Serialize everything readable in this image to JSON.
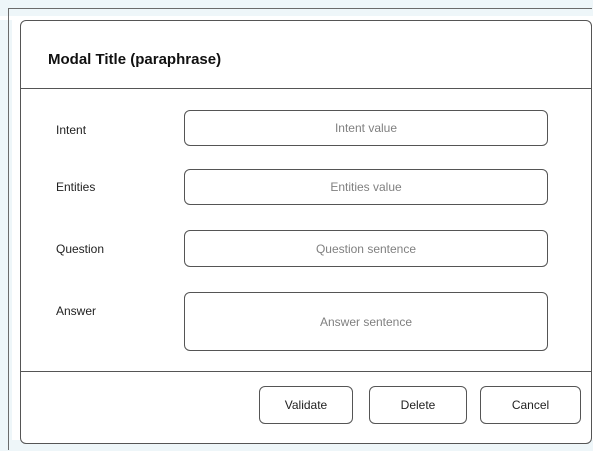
{
  "modal": {
    "title": "Modal Title (paraphrase)"
  },
  "fields": [
    {
      "label": "Intent",
      "placeholder": "Intent value"
    },
    {
      "label": "Entities",
      "placeholder": "Entities value"
    },
    {
      "label": "Question",
      "placeholder": "Question sentence"
    },
    {
      "label": "Answer",
      "placeholder": "Answer sentence"
    }
  ],
  "footer": {
    "validate_label": "Validate",
    "delete_label": "Delete",
    "cancel_label": "Cancel"
  },
  "colors": {
    "border": "#555555",
    "placeholder_text": "#808080",
    "watermark": "#d9eaf1"
  }
}
